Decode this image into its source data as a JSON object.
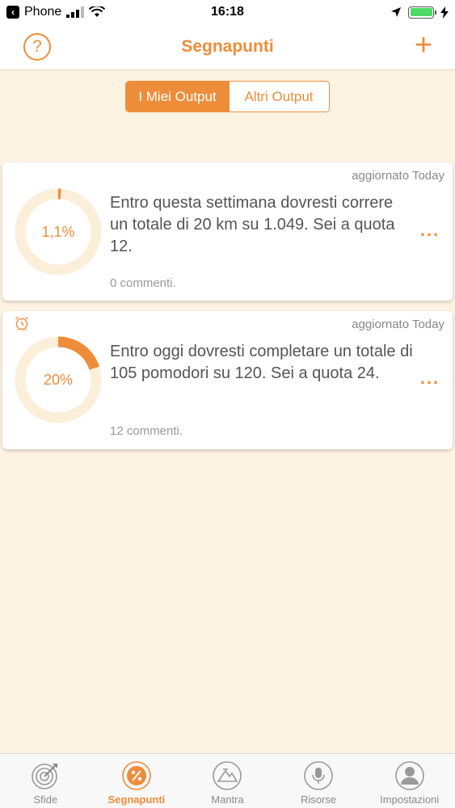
{
  "status_bar": {
    "carrier": "Phone",
    "time": "16:18"
  },
  "nav": {
    "title": "Segnapunti",
    "help_glyph": "?",
    "add_glyph": "+"
  },
  "segmented": {
    "active": "I Miei Output",
    "inactive": "Altri Output"
  },
  "cards": [
    {
      "updated": "aggiornato Today",
      "percent_label": "1,1%",
      "progress": 0.011,
      "text": "Entro questa settimana dovresti correre un totale di 20 km su 1.049. Sei a quota 12.",
      "comments": "0 commenti.",
      "more": "...",
      "alarm_icon": false
    },
    {
      "updated": "aggiornato Today",
      "percent_label": "20%",
      "progress": 0.2,
      "text": "Entro oggi dovresti completare un totale di 105 pomodori su 120. Sei a quota 24.",
      "comments": "12 commenti.",
      "more": "...",
      "alarm_icon": true
    }
  ],
  "tabs": [
    {
      "label": "Sfide",
      "icon": "target-icon",
      "active": false
    },
    {
      "label": "Segnapunti",
      "icon": "percent-icon",
      "active": true
    },
    {
      "label": "Mantra",
      "icon": "mountain-icon",
      "active": false
    },
    {
      "label": "Risorse",
      "icon": "microphone-icon",
      "active": false
    },
    {
      "label": "Impostazioni",
      "icon": "user-icon",
      "active": false
    }
  ],
  "colors": {
    "accent": "#ed8d3a",
    "background": "#fdf3e3",
    "ring_track": "#fcefd9"
  }
}
